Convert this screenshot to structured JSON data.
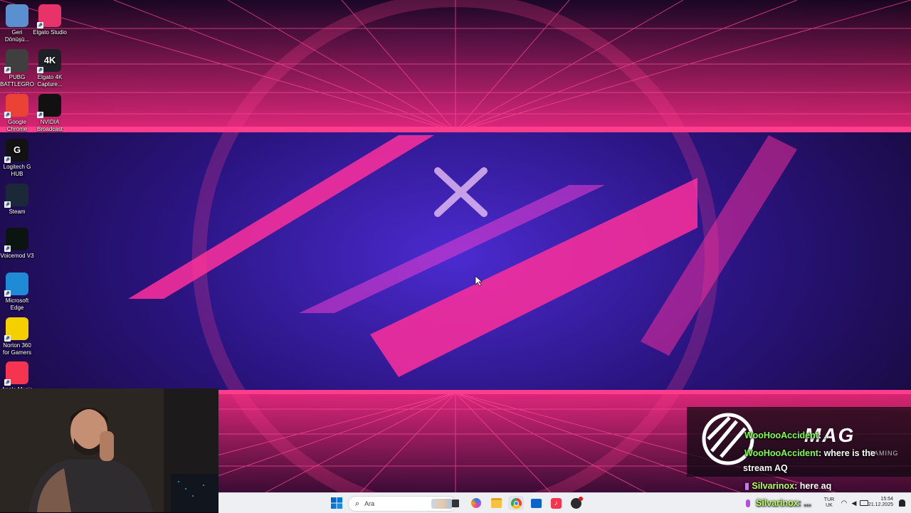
{
  "desktop": {
    "icons": [
      {
        "label": "Geri Dönüşü...",
        "icon": "recycle-bin-icon",
        "color": "#5a8fd0"
      },
      {
        "label": "Elgato Studio",
        "icon": "elgato-studio-icon",
        "color": "#e8336a"
      },
      {
        "label": "PUBG BATTLEGRO...",
        "icon": "pubg-icon",
        "color": "#3f3f3f"
      },
      {
        "label": "Elgato 4K Capture...",
        "icon": "elgato-4k-icon",
        "color": "#1f1f28",
        "glyph": "4K"
      },
      {
        "label": "Google Chrome",
        "icon": "chrome-icon",
        "color": "#ea4335"
      },
      {
        "label": "NVIDIA Broadcast",
        "icon": "nvidia-broadcast-icon",
        "color": "#111111"
      },
      {
        "label": "Logitech G HUB",
        "icon": "logitech-ghub-icon",
        "color": "#121212",
        "glyph": "G"
      },
      {
        "label": "Steam",
        "icon": "steam-icon",
        "color": "#1b2838"
      },
      {
        "label": "Voicemod V3",
        "icon": "voicemod-icon",
        "color": "#0c1412"
      },
      {
        "label": "Microsoft Edge",
        "icon": "edge-icon",
        "color": "#1f8ad6"
      },
      {
        "label": "Norton 360 for Gamers",
        "icon": "norton-icon",
        "color": "#f5d000"
      },
      {
        "label": "Apple Music",
        "icon": "apple-music-icon",
        "color": "#f5344f"
      }
    ]
  },
  "overlay": {
    "logo_text": "MAG",
    "logo_sub": "GAMING",
    "chat": [
      {
        "user": "WooHooAccident",
        "message": ": ..."
      },
      {
        "user": "WooHooAccident",
        "message": ": where is the"
      },
      {
        "user": "",
        "message": "stream AQ"
      },
      {
        "user": "Silvarinox",
        "message": ": here aq"
      },
      {
        "user": "Silvarinox",
        "message": ": ..."
      }
    ]
  },
  "taskbar": {
    "search_placeholder": "Ara",
    "language_top": "TUR",
    "language_bottom": "UK",
    "time": "15:54",
    "date": "21.12.2025",
    "accent": "#0067c0"
  }
}
